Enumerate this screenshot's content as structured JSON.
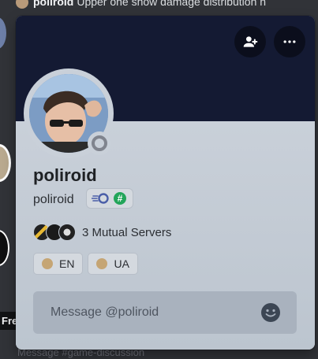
{
  "background": {
    "top_author": "poliroid",
    "top_message": "Upper one show damage distribution n",
    "tooltip": "Fre",
    "bottom_message": "Message #game-discussion"
  },
  "profile": {
    "display_name": "poliroid",
    "username": "poliroid",
    "badges": [
      "nitro-badge",
      "hashtag-badge"
    ],
    "badge_hash_glyph": "#",
    "status": "offline",
    "mutual_servers": "3 Mutual Servers",
    "roles": [
      {
        "label": "EN",
        "color": "#c5a574"
      },
      {
        "label": "UA",
        "color": "#c5a574"
      }
    ],
    "message_placeholder": "Message @poliroid",
    "banner_color": "#141a33"
  },
  "icons": {
    "add_friend": "add-friend-icon",
    "more": "more-icon",
    "emoji": "emoji-icon"
  }
}
